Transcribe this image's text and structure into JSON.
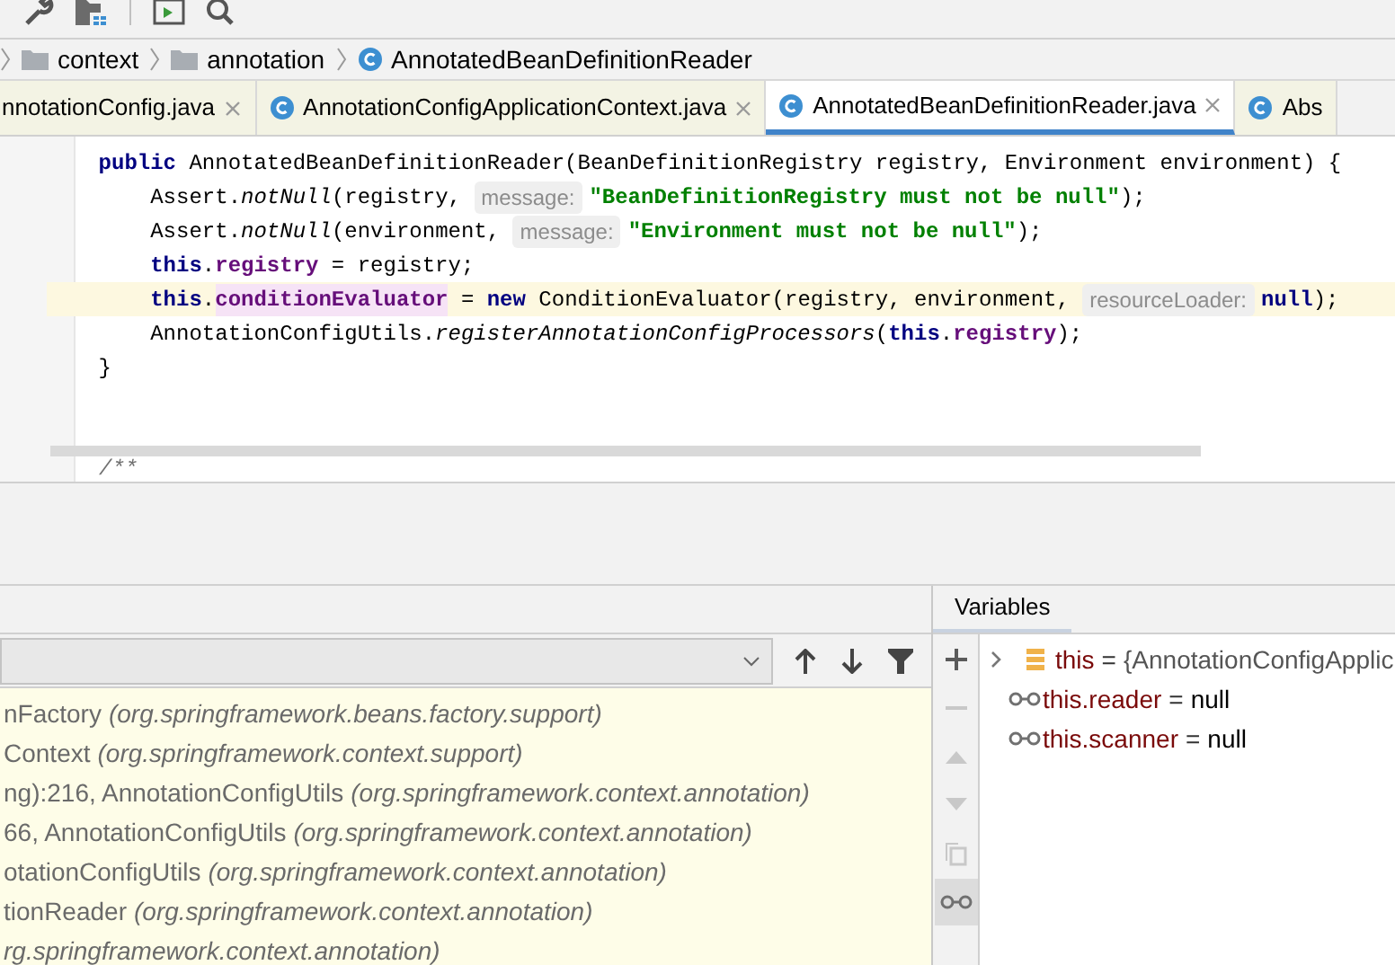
{
  "breadcrumbs": [
    {
      "kind": "folder",
      "label": "context"
    },
    {
      "kind": "folder",
      "label": "annotation"
    },
    {
      "kind": "class",
      "label": "AnnotatedBeanDefinitionReader"
    }
  ],
  "tabs": [
    {
      "label": "nnotationConfig.java",
      "selected": false,
      "closable": true
    },
    {
      "label": "AnnotationConfigApplicationContext.java",
      "selected": false,
      "closable": true
    },
    {
      "label": "AnnotatedBeanDefinitionReader.java",
      "selected": true,
      "closable": true
    },
    {
      "label": "Abs",
      "selected": false,
      "closable": false
    }
  ],
  "code_lines": [
    {
      "highlighted": false,
      "tokens": [
        {
          "kind": "keyword",
          "text": "    public "
        },
        {
          "kind": "plain",
          "text": "AnnotatedBeanDefinitionReader(BeanDefinitionRegistry registry, Environment environment) {"
        }
      ]
    },
    {
      "highlighted": false,
      "tokens": [
        {
          "kind": "plain",
          "text": "        Assert."
        },
        {
          "kind": "italic",
          "text": "notNull"
        },
        {
          "kind": "plain",
          "text": "(registry, "
        },
        {
          "kind": "hint",
          "text": "message:"
        },
        {
          "kind": "string",
          "text": "\"BeanDefinitionRegistry must not be null\""
        },
        {
          "kind": "plain",
          "text": ");"
        }
      ]
    },
    {
      "highlighted": false,
      "tokens": [
        {
          "kind": "plain",
          "text": "        Assert."
        },
        {
          "kind": "italic",
          "text": "notNull"
        },
        {
          "kind": "plain",
          "text": "(environment, "
        },
        {
          "kind": "hint",
          "text": "message:"
        },
        {
          "kind": "string",
          "text": "\"Environment must not be null\""
        },
        {
          "kind": "plain",
          "text": ");"
        }
      ]
    },
    {
      "highlighted": false,
      "tokens": [
        {
          "kind": "keyword",
          "text": "        this"
        },
        {
          "kind": "plain",
          "text": "."
        },
        {
          "kind": "field",
          "text": "registry"
        },
        {
          "kind": "plain",
          "text": " = registry;"
        }
      ]
    },
    {
      "highlighted": true,
      "tokens": [
        {
          "kind": "keyword",
          "text": "        this"
        },
        {
          "kind": "plain",
          "text": "."
        },
        {
          "kind": "field-hl",
          "text": "conditionEvaluator"
        },
        {
          "kind": "plain",
          "text": " = "
        },
        {
          "kind": "keyword",
          "text": "new "
        },
        {
          "kind": "plain",
          "text": "ConditionEvaluator(registry, environment, "
        },
        {
          "kind": "hint",
          "text": "resourceLoader:"
        },
        {
          "kind": "keyword",
          "text": "null"
        },
        {
          "kind": "plain",
          "text": ");"
        }
      ]
    },
    {
      "highlighted": false,
      "tokens": [
        {
          "kind": "plain",
          "text": "        AnnotationConfigUtils."
        },
        {
          "kind": "italic",
          "text": "registerAnnotationConfigProcessors"
        },
        {
          "kind": "plain",
          "text": "("
        },
        {
          "kind": "keyword",
          "text": "this"
        },
        {
          "kind": "plain",
          "text": "."
        },
        {
          "kind": "field",
          "text": "registry"
        },
        {
          "kind": "plain",
          "text": ");"
        }
      ]
    },
    {
      "highlighted": false,
      "tokens": [
        {
          "kind": "plain",
          "text": "    }"
        }
      ]
    }
  ],
  "comment_line": "/**",
  "frames": [
    {
      "method": "nFactory",
      "package": "(org.springframework.beans.factory.support)"
    },
    {
      "method": "Context",
      "package": "(org.springframework.context.support)"
    },
    {
      "method": "ng):216, AnnotationConfigUtils",
      "package": "(org.springframework.context.annotation)"
    },
    {
      "method": "66, AnnotationConfigUtils",
      "package": "(org.springframework.context.annotation)"
    },
    {
      "method": "otationConfigUtils",
      "package": "(org.springframework.context.annotation)"
    },
    {
      "method": "tionReader",
      "package": "(org.springframework.context.annotation)"
    },
    {
      "package": "rg.springframework.context.annotation)"
    }
  ],
  "variables_tab": {
    "label": "Variables"
  },
  "variables_toolbar": [
    {
      "kind": "plus",
      "disabled": false,
      "selected": false
    },
    {
      "kind": "minus",
      "disabled": true,
      "selected": false
    },
    {
      "kind": "up",
      "disabled": true,
      "selected": false
    },
    {
      "kind": "down",
      "disabled": true,
      "selected": false
    },
    {
      "kind": "copy",
      "disabled": true,
      "selected": false
    },
    {
      "kind": "watch",
      "disabled": false,
      "selected": true
    }
  ],
  "variables": [
    {
      "kind": "object",
      "name": "this",
      "operator": "=",
      "value": "{AnnotationConfigApplic"
    },
    {
      "kind": "watch",
      "name": "this.reader",
      "operator": "=",
      "value": "null"
    },
    {
      "kind": "watch",
      "name": "this.scanner",
      "operator": "=",
      "value": "null"
    }
  ]
}
